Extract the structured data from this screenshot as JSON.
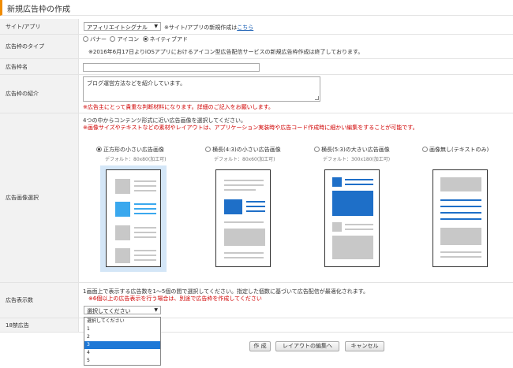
{
  "title": "新規広告枠の作成",
  "site_app": {
    "label": "サイト/アプリ",
    "selected": "アフィリエイトシグナル",
    "note_prefix": "※サイト/アプリの新規作成は",
    "note_link": "こちら"
  },
  "ad_type": {
    "label": "広告枠のタイプ",
    "options": [
      "バナー",
      "アイコン",
      "ネイティブアド"
    ],
    "selected_index": 2,
    "note": "※2016年6月17日よりiOSアプリにおけるアイコン型広告配信サービスの新規広告枠作成は終了しております。"
  },
  "ad_name": {
    "label": "広告枠名",
    "value": ""
  },
  "ad_intro": {
    "label": "広告枠の紹介",
    "value": "ブログ運営方法などを紹介しています。",
    "warning": "※広告主にとって貴重な判断材料になります。詳細のご記入をお願いします。"
  },
  "ad_image": {
    "label": "広告画像選択",
    "instruction": "4つの中からコンテンツ形式に近い広告画像を選択してください。",
    "warning": "※画像サイズやテキストなどの素材やレイアウトは、アプリケーション実装時や広告コード作成時に細かい編集をすることが可能です。",
    "options": [
      {
        "label": "正方形の小さい広告画像",
        "default": "デフォルト：80x80(加工可)",
        "selected": true
      },
      {
        "label": "横長(4:3)の小さい広告画像",
        "default": "デフォルト：80x60(加工可)",
        "selected": false
      },
      {
        "label": "横長(5:3)の大きい広告画像",
        "default": "デフォルト：300x180(加工可)",
        "selected": false
      },
      {
        "label": "画像無し(テキストのみ)",
        "default": "",
        "selected": false
      }
    ]
  },
  "ad_count": {
    "label": "広告表示数",
    "instruction": "1画面上で表示する広告数を1～5個の間で選択してください。指定した個数に基づいて広告配信が最適化されます。",
    "warning": "※6個以上の広告表示を行う場合は、別途で広告枠を作成してください",
    "selected": "選択してください",
    "options": [
      "選択してください",
      "1",
      "2",
      "3",
      "4",
      "5"
    ],
    "highlighted_index": 3
  },
  "adult": {
    "label": "18禁広告"
  },
  "buttons": {
    "create": "作 成",
    "edit_layout": "レイアウトの編集へ",
    "cancel": "キャンセル"
  },
  "colors": {
    "accent": "#f08c00",
    "warning": "#d00000",
    "selected_blue": "#3aa8ee",
    "preview_blue": "#1e6fc8",
    "highlight": "#1e78d6"
  }
}
